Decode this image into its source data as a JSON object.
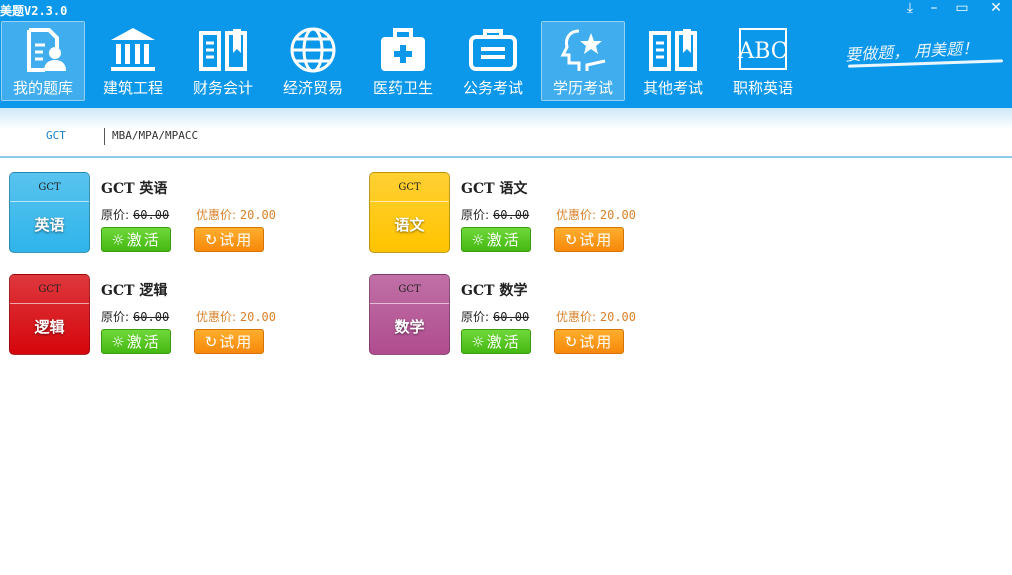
{
  "app": {
    "title": "美题V2.3.0",
    "slogan": "要做题， 用美题！"
  },
  "window_controls": [
    {
      "name": "download",
      "glyph": "⤓"
    },
    {
      "name": "minimize",
      "glyph": "–"
    },
    {
      "name": "maximize",
      "glyph": "▭"
    },
    {
      "name": "close",
      "glyph": "✕"
    }
  ],
  "nav": [
    {
      "label": "我的题库",
      "icon": "user-document-icon",
      "active": true
    },
    {
      "label": "建筑工程",
      "icon": "building-icon",
      "active": false
    },
    {
      "label": "财务会计",
      "icon": "book-icon",
      "active": false
    },
    {
      "label": "经济贸易",
      "icon": "globe-icon",
      "active": false
    },
    {
      "label": "医药卫生",
      "icon": "medkit-icon",
      "active": false
    },
    {
      "label": "公务考试",
      "icon": "briefcase-icon",
      "active": false
    },
    {
      "label": "学历考试",
      "icon": "graduate-icon",
      "active": true
    },
    {
      "label": "其他考试",
      "icon": "book-icon",
      "active": false
    },
    {
      "label": "职称英语",
      "icon": "abc-icon",
      "active": false
    }
  ],
  "subnav": [
    {
      "label": "GCT",
      "active": true
    },
    {
      "label": "MBA/MPA/MPACC",
      "active": false
    }
  ],
  "labels": {
    "original": "原价:",
    "discount": "优惠价:",
    "activate": "激活",
    "trial": "试用"
  },
  "courses": [
    {
      "tag": "GCT",
      "subject": "英语",
      "name": "GCT 英语",
      "original_price": "60.00",
      "discount_price": "20.00",
      "color": "#2fb4ea"
    },
    {
      "tag": "GCT",
      "subject": "语文",
      "name": "GCT 语文",
      "original_price": "60.00",
      "discount_price": "20.00",
      "color": "#ffc400"
    },
    {
      "tag": "GCT",
      "subject": "逻辑",
      "name": "GCT 逻辑",
      "original_price": "60.00",
      "discount_price": "20.00",
      "color": "#d5060c"
    },
    {
      "tag": "GCT",
      "subject": "数学",
      "name": "GCT 数学",
      "original_price": "60.00",
      "discount_price": "20.00",
      "color": "#b04c8f"
    }
  ]
}
